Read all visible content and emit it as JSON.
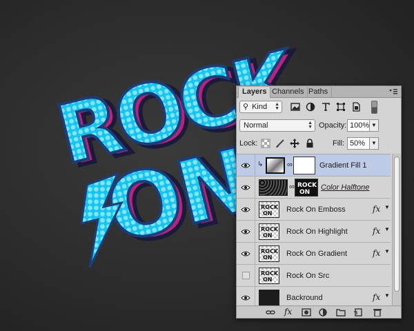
{
  "artwork": {
    "title_line1": "ROCK",
    "title_line2": "ON",
    "fill_color": "#1ec8f0",
    "shadow_color": "#cc2a8a",
    "dark_edge": "#1a2c5a"
  },
  "panel": {
    "tabs": [
      {
        "label": "Layers",
        "active": true
      },
      {
        "label": "Channels",
        "active": false
      },
      {
        "label": "Paths",
        "active": false
      }
    ],
    "filter_kind": "Kind",
    "blend_mode": "Normal",
    "opacity_label": "Opacity:",
    "opacity_value": "100%",
    "lock_label": "Lock:",
    "fill_label": "Fill:",
    "fill_value": "50%"
  },
  "layers": [
    {
      "name": "Gradient Fill 1",
      "visible": true,
      "selected": true,
      "fx": false,
      "type": "gradient-fill"
    },
    {
      "name": "Color Halftone",
      "visible": true,
      "selected": false,
      "fx": false,
      "type": "adjustment",
      "underlined": true
    },
    {
      "name": "Rock On Emboss",
      "visible": true,
      "selected": false,
      "fx": true,
      "type": "text-art"
    },
    {
      "name": "Rock On Highlight",
      "visible": true,
      "selected": false,
      "fx": true,
      "type": "text-art"
    },
    {
      "name": "Rock On Gradient",
      "visible": true,
      "selected": false,
      "fx": true,
      "type": "text-art"
    },
    {
      "name": "Rock On Src",
      "visible": false,
      "selected": false,
      "fx": false,
      "type": "text-art"
    },
    {
      "name": "Backround",
      "visible": true,
      "selected": false,
      "fx": true,
      "type": "fill-dark"
    }
  ],
  "fx_label": "fx",
  "selection_color": "#bdcbe6"
}
